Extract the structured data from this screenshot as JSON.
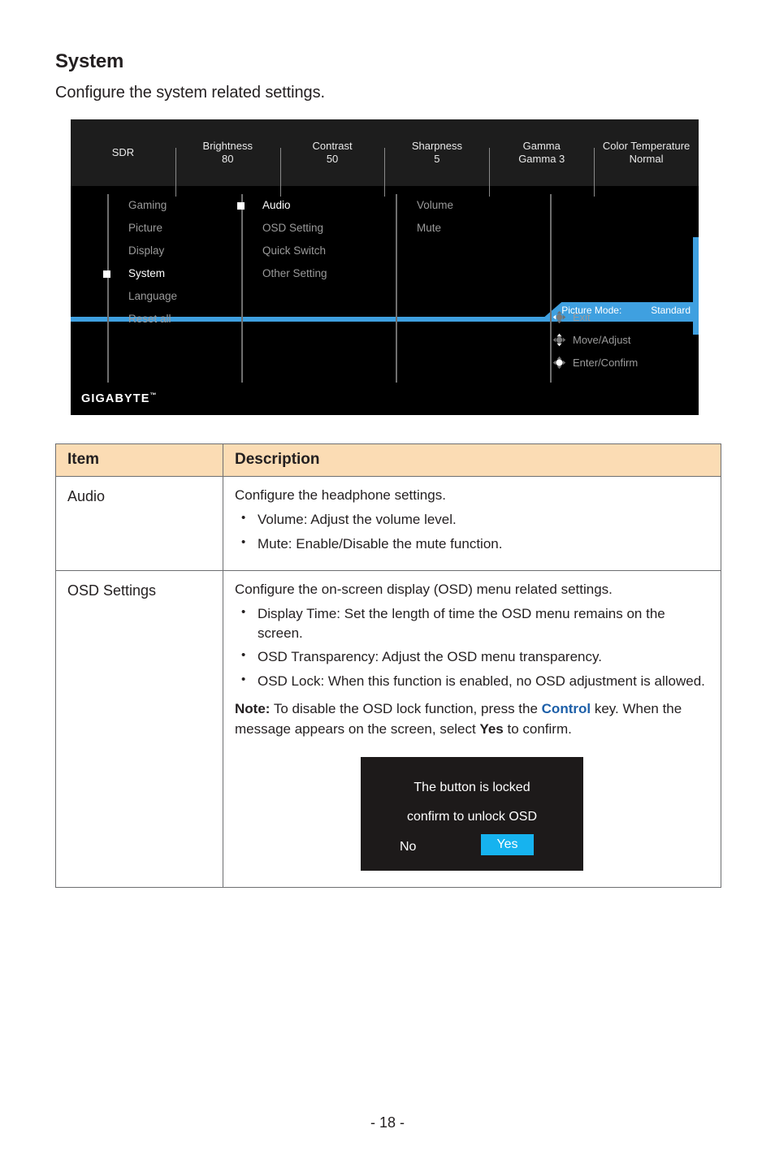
{
  "page": {
    "heading": "System",
    "subheading": "Configure the system related settings.",
    "page_number": "- 18 -"
  },
  "osd": {
    "top_bar": [
      {
        "label": "SDR",
        "value": ""
      },
      {
        "label": "Brightness",
        "value": "80"
      },
      {
        "label": "Contrast",
        "value": "50"
      },
      {
        "label": "Sharpness",
        "value": "5"
      },
      {
        "label": "Gamma",
        "value": "Gamma 3"
      },
      {
        "label": "Color Temperature",
        "value": "Normal"
      }
    ],
    "picture_mode": {
      "label": "Picture Mode:",
      "value": "Standard"
    },
    "column1": [
      {
        "label": "Gaming",
        "active": false
      },
      {
        "label": "Picture",
        "active": false
      },
      {
        "label": "Display",
        "active": false
      },
      {
        "label": "System",
        "active": true
      },
      {
        "label": "Language",
        "active": false
      },
      {
        "label": "Reset all",
        "active": false
      }
    ],
    "column2": [
      {
        "label": "Audio",
        "active": true
      },
      {
        "label": "OSD Setting",
        "active": false
      },
      {
        "label": "Quick Switch",
        "active": false
      },
      {
        "label": "Other Setting",
        "active": false
      }
    ],
    "column3": [
      {
        "label": "Volume",
        "active": false
      },
      {
        "label": "Mute",
        "active": false
      }
    ],
    "legend": [
      {
        "icon": "dpad-left-icon",
        "label": "Exit"
      },
      {
        "icon": "dpad-updown-icon",
        "label": "Move/Adjust"
      },
      {
        "icon": "dpad-center-icon",
        "label": "Enter/Confirm"
      }
    ],
    "brand": "GIGABYTE",
    "brand_tm": "™",
    "accent_color": "#3fa0e0"
  },
  "table": {
    "headers": {
      "item": "Item",
      "description": "Description"
    },
    "rows": [
      {
        "item": "Audio",
        "lead": "Configure the headphone settings.",
        "bullets": [
          "Volume: Adjust the volume level.",
          "Mute: Enable/Disable the mute function."
        ]
      },
      {
        "item": "OSD Settings",
        "lead": "Configure the on-screen display (OSD) menu related settings.",
        "bullets": [
          "Display Time: Set the length of time the OSD menu remains on the screen.",
          "OSD Transparency: Adjust the OSD menu transparency.",
          "OSD Lock: When this function is enabled, no OSD adjustment is allowed."
        ],
        "note": {
          "label": "Note:",
          "text_before": " To disable the OSD lock function, press the ",
          "accent": "Control",
          "text_mid": " key. When the message appears on the screen, select ",
          "bold": "Yes",
          "text_after": " to confirm.",
          "accent_color": "#1d5fa8"
        },
        "dialog": {
          "line1": "The button is locked",
          "line2": "confirm to unlock OSD",
          "no": "No",
          "yes": "Yes",
          "yes_color": "#16b3ef"
        }
      }
    ]
  }
}
